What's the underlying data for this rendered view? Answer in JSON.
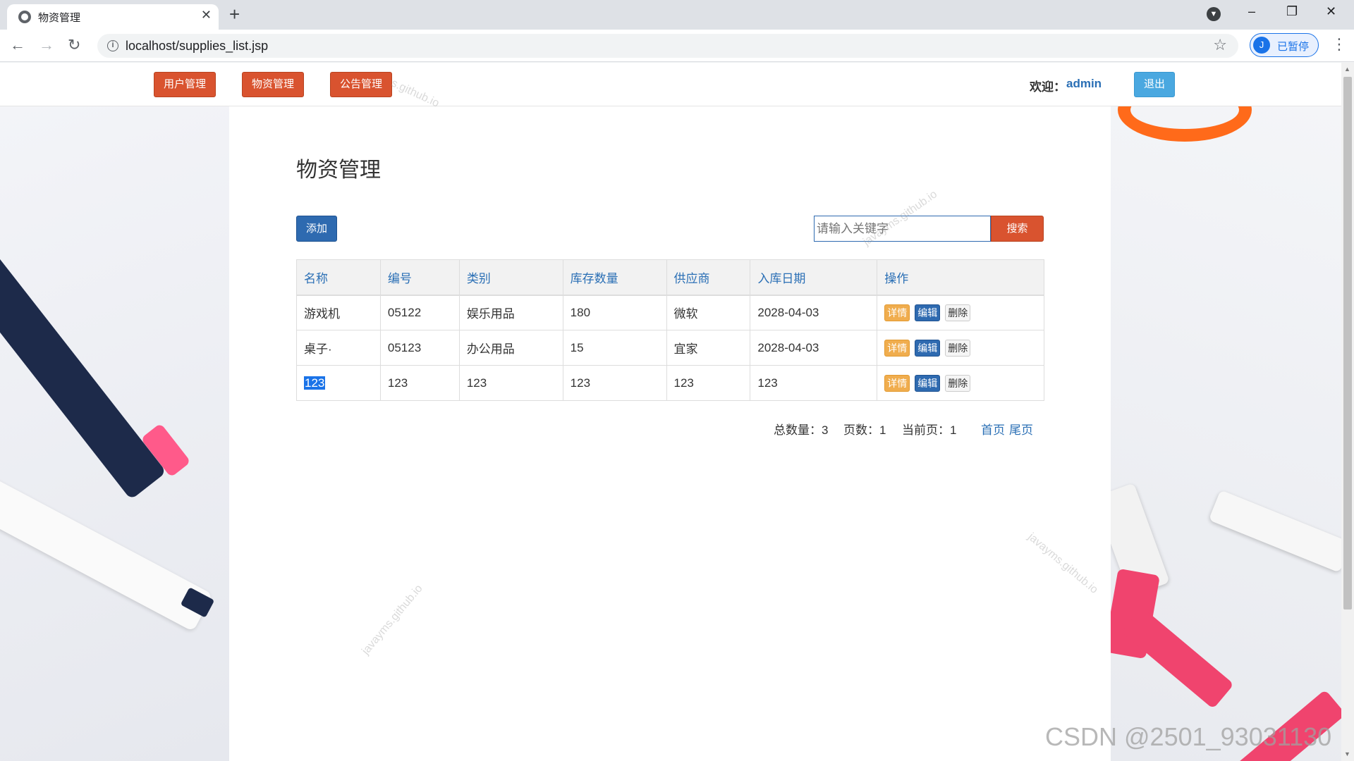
{
  "browser": {
    "tab_title": "物资管理",
    "tab_close": "✕",
    "new_tab": "+",
    "url": "localhost/supplies_list.jsp",
    "profile_initial": "J",
    "profile_status": "已暂停",
    "minimize": "–",
    "restore": "❐",
    "close": "✕",
    "back": "←",
    "forward": "→",
    "reload": "↻",
    "info": "i",
    "star": "☆",
    "menu": "⋮",
    "profile_drop": "▼"
  },
  "nav": {
    "items": [
      {
        "label": "用户管理"
      },
      {
        "label": "物资管理"
      },
      {
        "label": "公告管理"
      }
    ],
    "welcome_label": "欢迎：",
    "username": "admin",
    "logout_label": "退出"
  },
  "page": {
    "title": "物资管理",
    "add_label": "添加",
    "search_placeholder": "请输入关键字",
    "search_label": "搜索"
  },
  "table": {
    "headers": [
      "名称",
      "编号",
      "类别",
      "库存数量",
      "供应商",
      "入库日期",
      "操作"
    ],
    "rows": [
      [
        "游戏机",
        "05122",
        "娱乐用品",
        "180",
        "微软",
        "2028-04-03"
      ],
      [
        "桌子·",
        "05123",
        "办公用品",
        "15",
        "宜家",
        "2028-04-03"
      ],
      [
        "123",
        "123",
        "123",
        "123",
        "123",
        "123"
      ]
    ],
    "actions": {
      "detail": "详情",
      "edit": "编辑",
      "delete": "删除"
    }
  },
  "pager": {
    "total": "总数量：3",
    "pages": "页数：1",
    "current": "当前页：1",
    "first": "首页",
    "last": "尾页"
  },
  "watermarks": {
    "w1": "s.github.io",
    "w2": "javayms.github.io",
    "w3": "javayms.github.io",
    "w4": "javayms.github.io",
    "csdn": "CSDN @2501_93031130"
  },
  "colors": {
    "nav_button": "#d9532f",
    "primary": "#2e6ab0",
    "link": "#2a6fb5",
    "warning": "#f0ad4e",
    "logout": "#4aa8e0"
  }
}
